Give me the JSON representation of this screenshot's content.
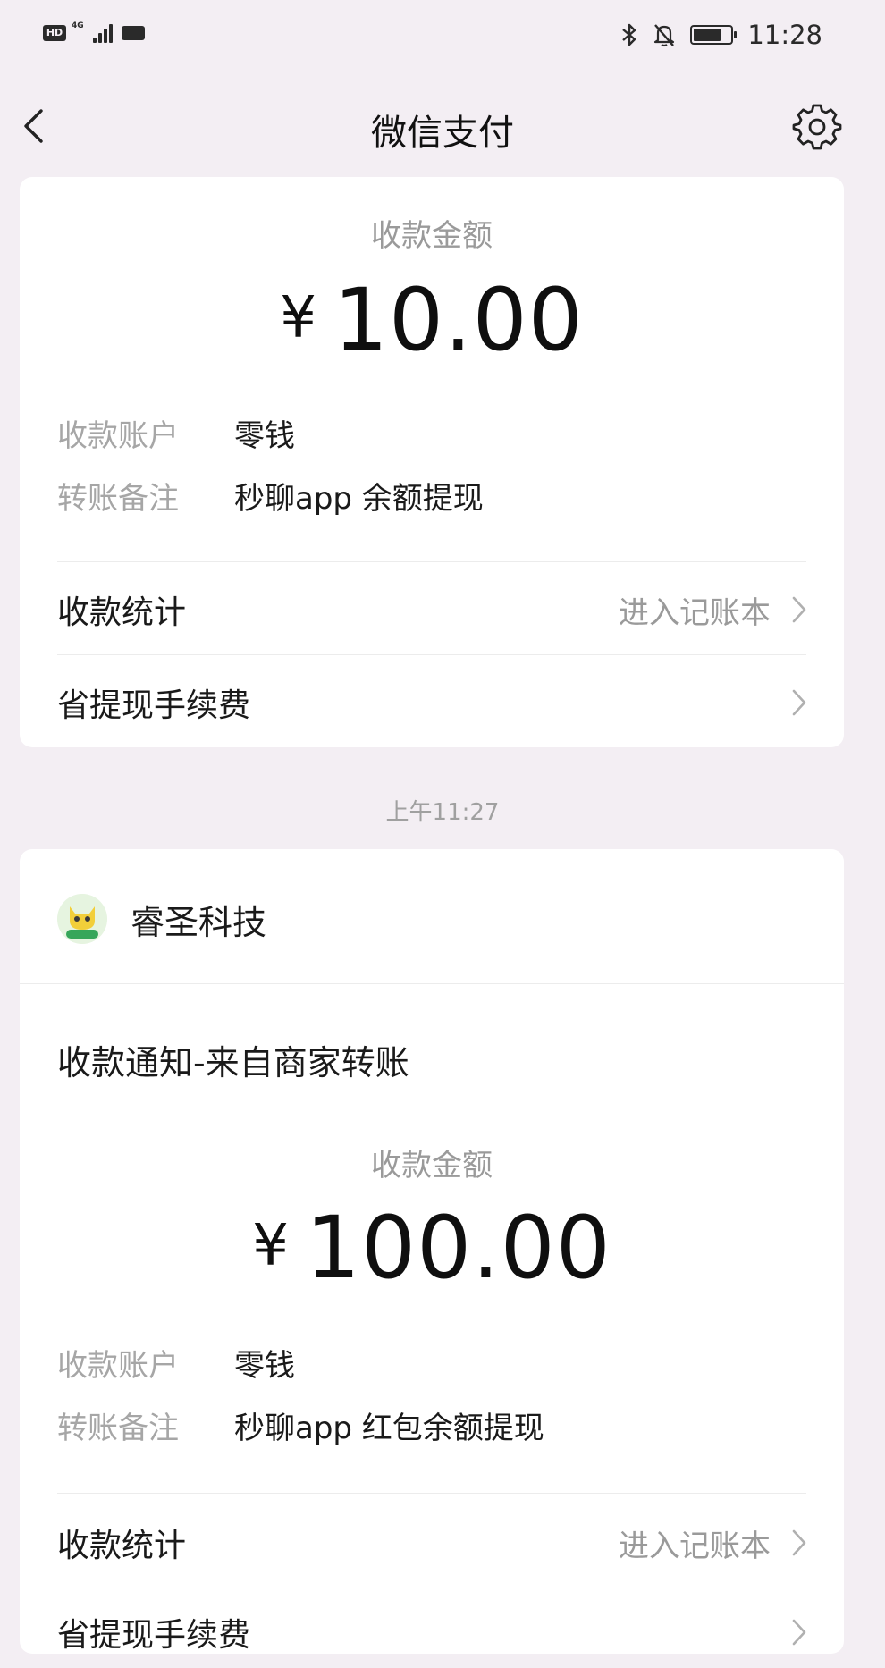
{
  "status_bar": {
    "hd_label": "HD",
    "network": "4G",
    "time": "11:28",
    "battery_level": 0.75,
    "icons": [
      "bluetooth-icon",
      "mute-bell-icon",
      "battery-icon"
    ]
  },
  "nav": {
    "title": "微信支付",
    "back_icon": "chevron-left-icon",
    "settings_icon": "gear-icon"
  },
  "card1": {
    "amount_label": "收款金额",
    "currency": "¥",
    "amount": "10.00",
    "account_key": "收款账户",
    "account_value": "零钱",
    "note_key": "转账备注",
    "note_value": "秒聊app 余额提现",
    "stats_label": "收款统计",
    "stats_link": "进入记账本",
    "fee_label": "省提现手续费"
  },
  "time_label": "上午11:27",
  "card2": {
    "merchant_name": "睿圣科技",
    "notice_title": "收款通知-来自商家转账",
    "amount_label": "收款金额",
    "currency": "¥",
    "amount": "100.00",
    "account_key": "收款账户",
    "account_value": "零钱",
    "note_key": "转账备注",
    "note_value": "秒聊app 红包余额提现",
    "stats_label": "收款统计",
    "stats_link": "进入记账本",
    "fee_label": "省提现手续费"
  },
  "colors": {
    "background": "#f3eef3",
    "card": "#ffffff",
    "muted_text": "#9a9a9a",
    "primary_text": "#1a1a1a"
  }
}
